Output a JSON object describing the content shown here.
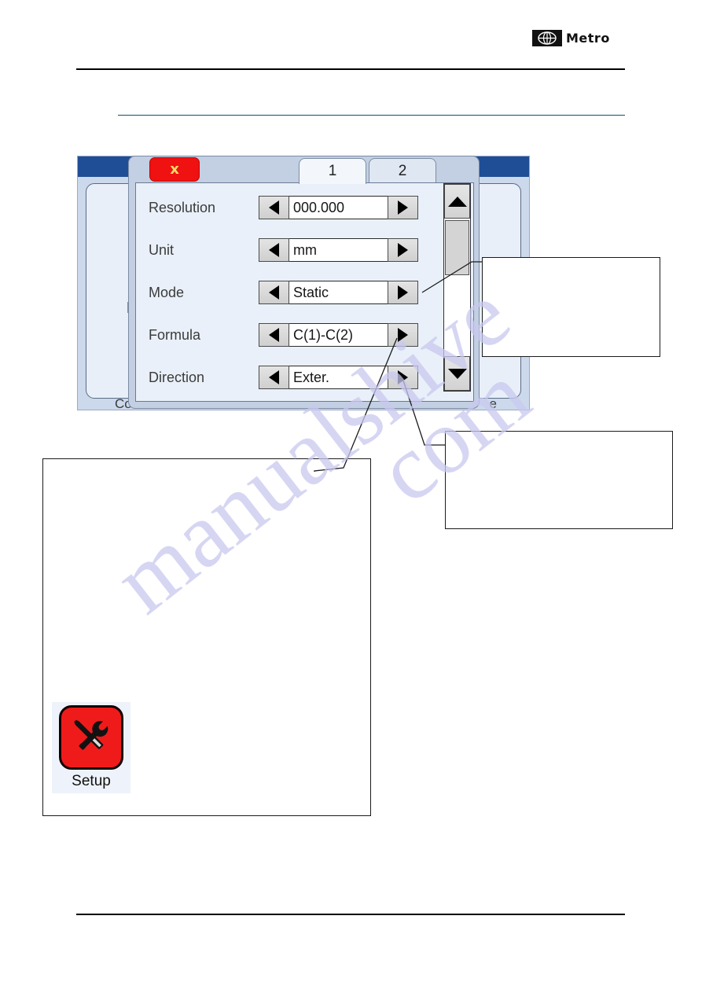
{
  "brand": {
    "name": "Metro",
    "globe_icon": "globe-icon"
  },
  "background_window": {
    "title": "",
    "left_partial_label": "Co",
    "right_partial_label": "e"
  },
  "dialog": {
    "close_label": "x",
    "tabs": [
      {
        "label": "1",
        "active": true
      },
      {
        "label": "2",
        "active": false
      }
    ],
    "prev_arrow": "left-arrow-icon",
    "next_arrow": "right-arrow-icon",
    "fields": [
      {
        "label": "Resolution",
        "value": "000.000"
      },
      {
        "label": "Unit",
        "value": "mm"
      },
      {
        "label": "Mode",
        "value": "Static"
      },
      {
        "label": "Formula",
        "value": "C(1)-C(2)"
      },
      {
        "label": "Direction",
        "value": "Exter."
      }
    ],
    "scrollbar": {
      "up_icon": "scroll-up-arrow-icon",
      "down_icon": "scroll-down-arrow-icon",
      "thumb": "scrollbar-thumb"
    }
  },
  "callouts": {
    "upper": "",
    "lower": "",
    "big": ""
  },
  "setup_tile": {
    "caption": "Setup",
    "icon": "wrench-screwdriver-icon"
  },
  "watermark": {
    "line_a": "manualshive",
    "line_b": "com"
  },
  "colors": {
    "accent_red": "#f01111",
    "title_blue": "#1f4e96",
    "rule_teal": "#14506b",
    "dialog_chrome": "#c3cfe2",
    "dialog_field_bg": "#e9f0f9"
  }
}
